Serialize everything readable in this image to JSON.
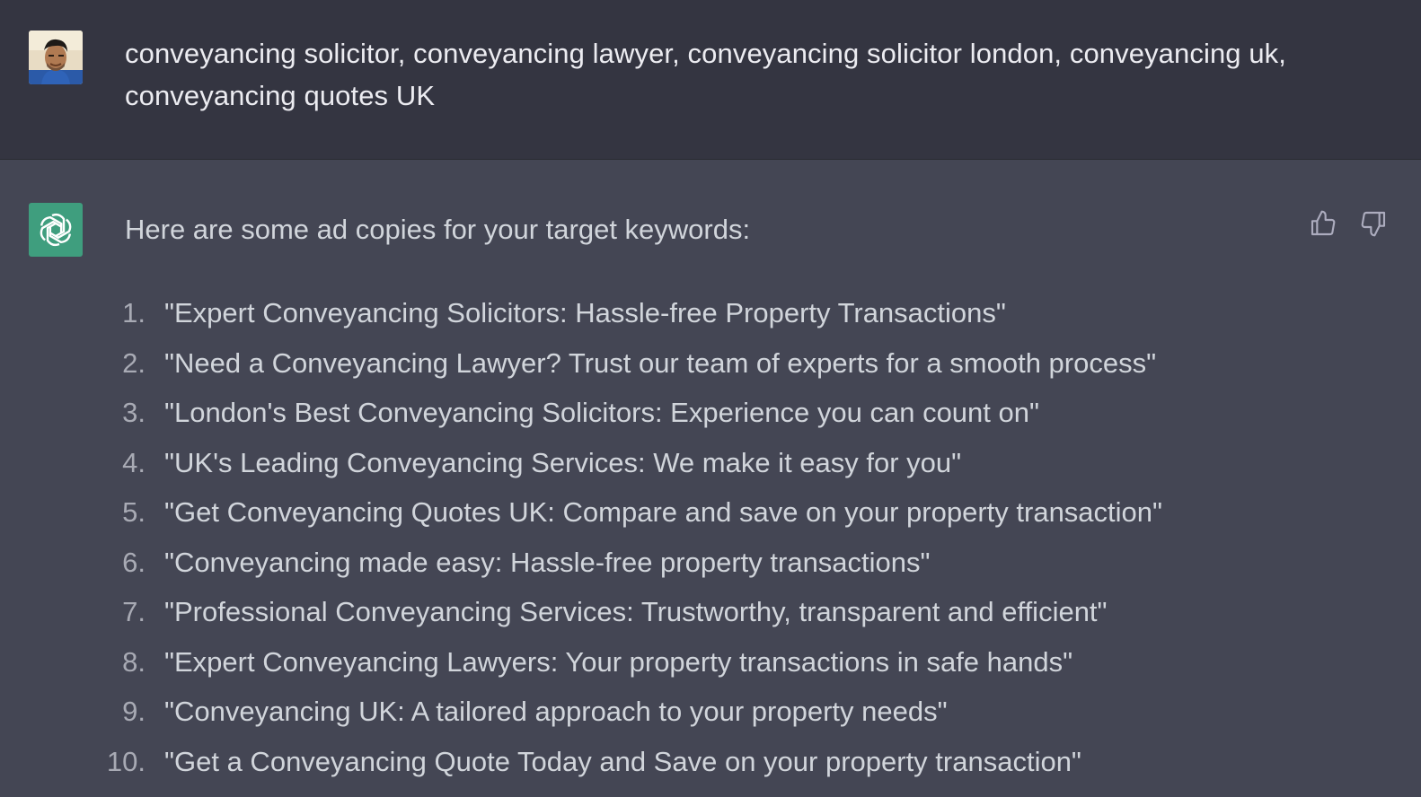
{
  "user": {
    "avatar_icon": "user-photo-avatar",
    "message": "conveyancing solicitor, conveyancing lawyer, conveyancing solicitor london, conveyancing uk, conveyancing quotes UK"
  },
  "assistant": {
    "avatar_icon": "openai-logo-icon",
    "avatar_color": "#3f9e7e",
    "intro": "Here are some ad copies for your target keywords:",
    "items": [
      {
        "num": "1.",
        "text": "\"Expert Conveyancing Solicitors: Hassle-free Property Transactions\""
      },
      {
        "num": "2.",
        "text": "\"Need a Conveyancing Lawyer? Trust our team of experts for a smooth process\""
      },
      {
        "num": "3.",
        "text": "\"London's Best Conveyancing Solicitors: Experience you can count on\""
      },
      {
        "num": "4.",
        "text": "\"UK's Leading Conveyancing Services: We make it easy for you\""
      },
      {
        "num": "5.",
        "text": "\"Get Conveyancing Quotes UK: Compare and save on your property transaction\""
      },
      {
        "num": "6.",
        "text": "\"Conveyancing made easy: Hassle-free property transactions\""
      },
      {
        "num": "7.",
        "text": "\"Professional Conveyancing Services: Trustworthy, transparent and efficient\""
      },
      {
        "num": "8.",
        "text": "\"Expert Conveyancing Lawyers: Your property transactions in safe hands\""
      },
      {
        "num": "9.",
        "text": "\"Conveyancing UK: A tailored approach to your property needs\""
      },
      {
        "num": "10.",
        "text": "\"Get a Conveyancing Quote Today and Save on your property transaction\""
      }
    ],
    "feedback": {
      "up_icon": "thumbs-up-icon",
      "down_icon": "thumbs-down-icon"
    }
  },
  "colors": {
    "user_bg": "#343541",
    "assistant_bg": "#444654",
    "text": "#d1d5db"
  }
}
